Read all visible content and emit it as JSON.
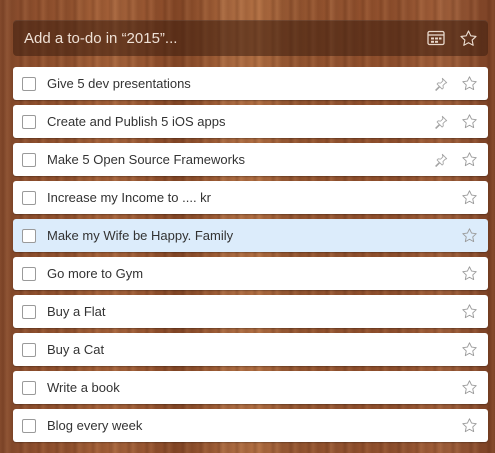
{
  "add_bar": {
    "placeholder": "Add a to-do in “2015”...",
    "icons": [
      "calendar-icon",
      "star-icon"
    ]
  },
  "todos": [
    {
      "title": "Give 5 dev presentations",
      "pinned": true,
      "starred": false,
      "selected": false
    },
    {
      "title": "Create and Publish 5 iOS apps",
      "pinned": true,
      "starred": false,
      "selected": false
    },
    {
      "title": "Make 5 Open Source Frameworks",
      "pinned": true,
      "starred": false,
      "selected": false
    },
    {
      "title": "Increase my Income to .... kr",
      "pinned": false,
      "starred": false,
      "selected": false
    },
    {
      "title": "Make my Wife be Happy. Family",
      "pinned": false,
      "starred": false,
      "selected": true
    },
    {
      "title": "Go more to Gym",
      "pinned": false,
      "starred": false,
      "selected": false
    },
    {
      "title": "Buy a Flat",
      "pinned": false,
      "starred": false,
      "selected": false
    },
    {
      "title": "Buy a Cat",
      "pinned": false,
      "starred": false,
      "selected": false
    },
    {
      "title": "Write a book",
      "pinned": false,
      "starred": false,
      "selected": false
    },
    {
      "title": "Blog every week",
      "pinned": false,
      "starred": false,
      "selected": false
    }
  ],
  "colors": {
    "selected_row": "#dcecfb",
    "icon_gray": "#9a9a9a",
    "add_bar_text": "#efe1d6"
  }
}
